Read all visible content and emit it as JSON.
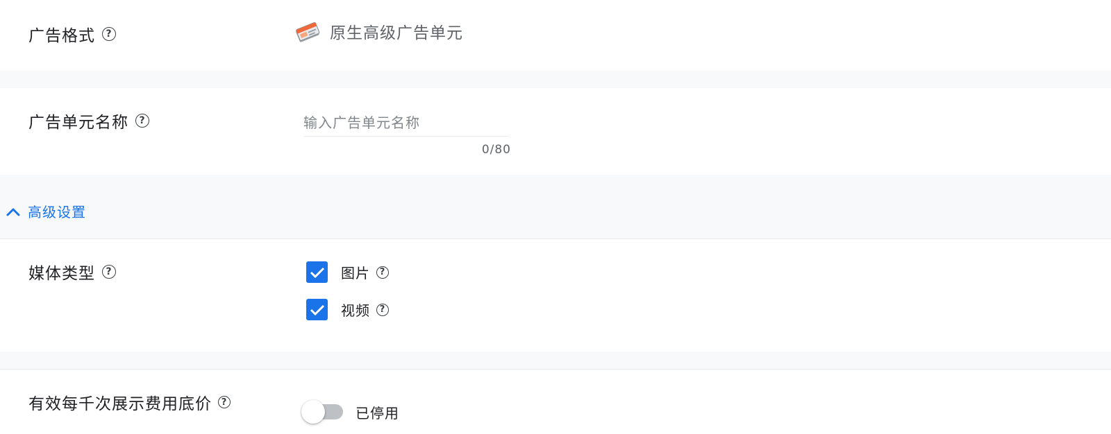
{
  "ad_format": {
    "label": "广告格式",
    "value": "原生高级广告单元",
    "icon": "native-ad-format-icon"
  },
  "ad_unit_name": {
    "label": "广告单元名称",
    "placeholder": "输入广告单元名称",
    "value": "",
    "counter": "0/80"
  },
  "advanced": {
    "label": "高级设置",
    "expanded": true
  },
  "media_type": {
    "label": "媒体类型",
    "options": [
      {
        "label": "图片",
        "checked": true
      },
      {
        "label": "视频",
        "checked": true
      }
    ]
  },
  "floor_price": {
    "label": "有效每千次展示费用底价",
    "switch_label": "已停用",
    "enabled": false
  },
  "help_symbol": "?",
  "colors": {
    "accent": "#1a73e8",
    "gap_background": "#f8f9fa",
    "switch_track_off": "#bdc1c6"
  }
}
